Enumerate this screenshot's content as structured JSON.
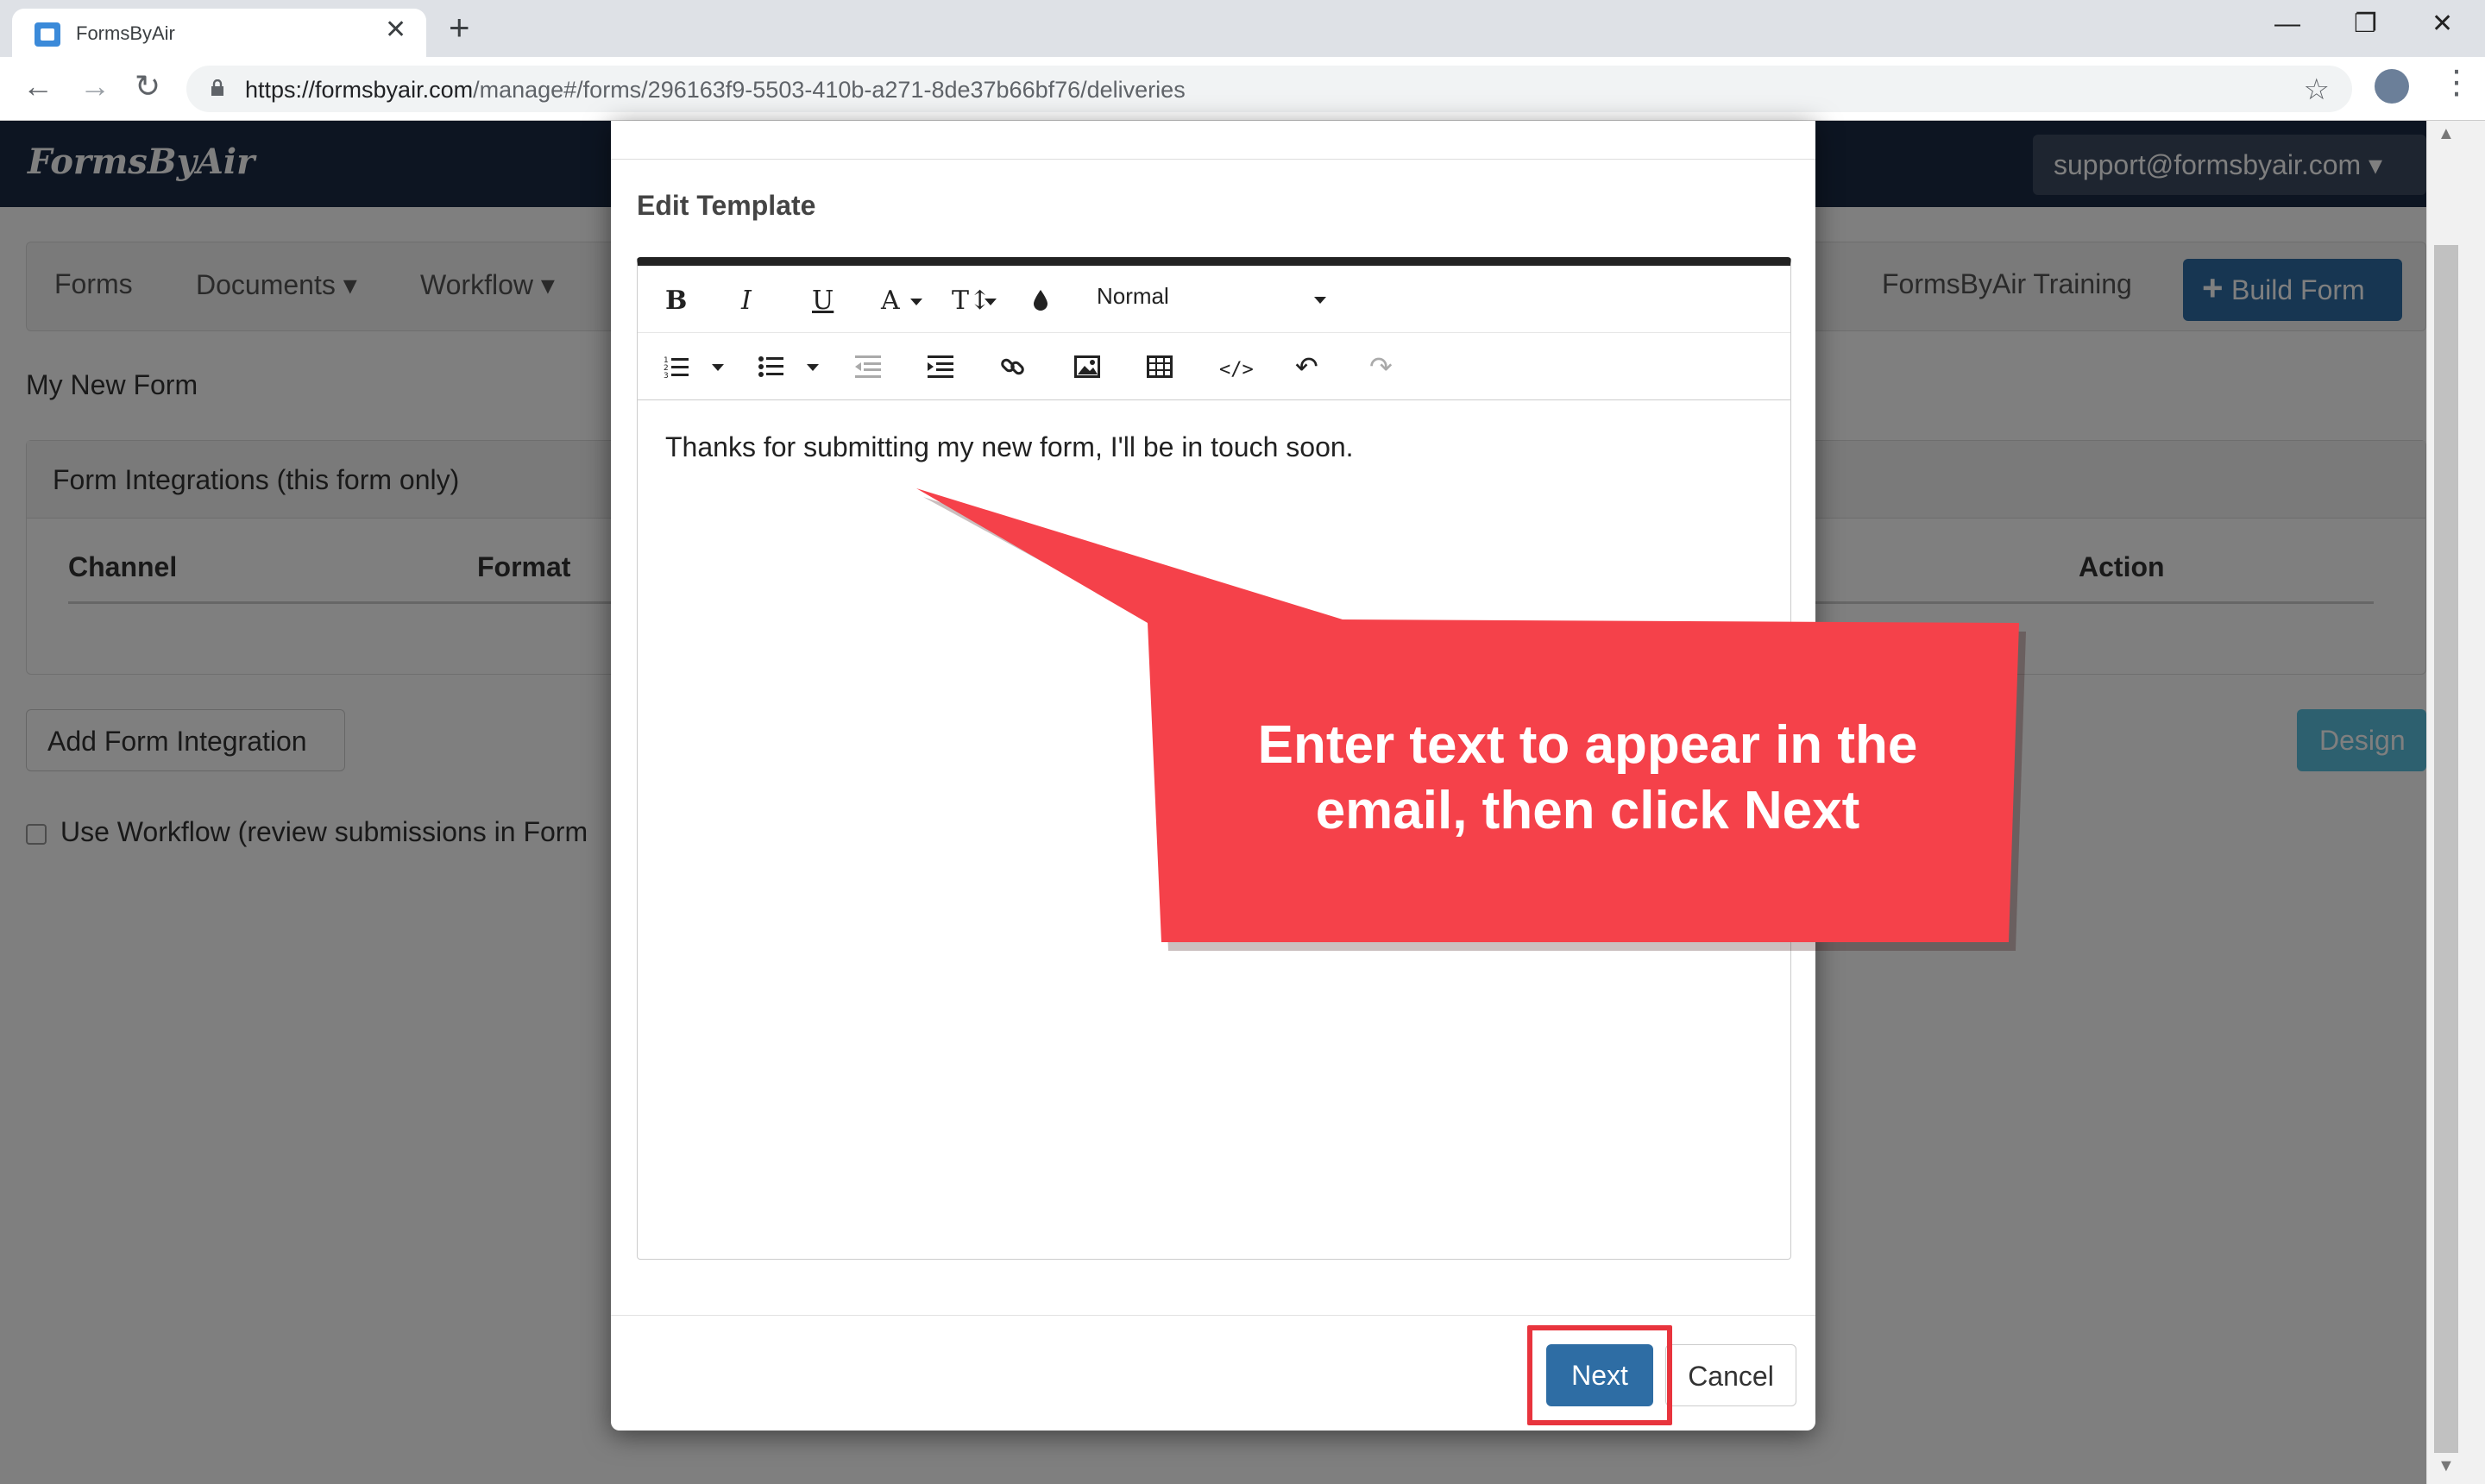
{
  "browser": {
    "tab_title": "FormsByAir",
    "close_tab": "✕",
    "new_tab": "+",
    "url_host": "https://formsbyair.com",
    "url_path": "/manage#/forms/296163f9-5503-410b-a271-8de37b66bf76/deliveries",
    "window_controls": [
      "—",
      "❐",
      "✕"
    ],
    "nav_icons": [
      "back-arrow-icon",
      "forward-arrow-icon",
      "reload-icon"
    ]
  },
  "app": {
    "logo": "FormsByAir",
    "user_menu": "support@formsbyair.com ▾",
    "menu": {
      "forms": "Forms",
      "documents": "Documents ▾",
      "workflow": "Workflow ▾",
      "training": "FormsByAir Training",
      "build_form": "Build Form"
    },
    "page_title": "My New Form",
    "panel_title": "Form Integrations (this form only)",
    "columns": {
      "channel": "Channel",
      "format": "Format",
      "action": "Action"
    },
    "add_integration": "Add Form Integration",
    "design": "Design",
    "use_workflow": "Use Workflow (review submissions in Form"
  },
  "modal": {
    "subtitle": "Edit Template",
    "toolbar": {
      "bold": "B",
      "italic": "I",
      "underline": "U",
      "font_color": "A",
      "text_size": "T↕",
      "format_select": "Normal"
    },
    "content": "Thanks for submitting my new form, I'll be in touch soon.",
    "next": "Next",
    "cancel": "Cancel"
  },
  "callout": {
    "line1": "Enter text to appear in the",
    "line2": "email, then click Next",
    "color": "#f5414a"
  }
}
